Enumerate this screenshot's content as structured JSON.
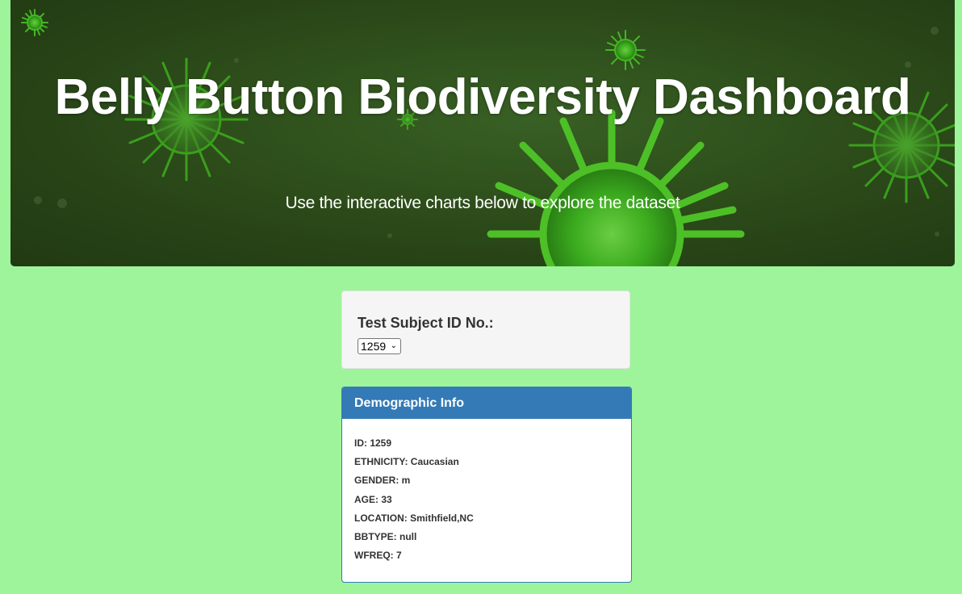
{
  "header": {
    "title": "Belly Button Biodiversity Dashboard",
    "subtitle": "Use the interactive charts below to explore the dataset"
  },
  "selector": {
    "label": "Test Subject ID No.:",
    "selected_value": "1259"
  },
  "demographics": {
    "heading": "Demographic Info",
    "lines": [
      "ID: 1259",
      "ETHNICITY: Caucasian",
      "GENDER: m",
      "AGE: 33",
      "LOCATION: Smithfield,NC",
      "BBTYPE: null",
      "WFREQ: 7"
    ]
  },
  "colors": {
    "page_background": "#9ef49a",
    "panel_primary": "#337ab7",
    "hero_dark_green": "#2a4718",
    "virus_green": "#4dd82c"
  },
  "icons": {
    "hero_background": "virus-illustration"
  }
}
